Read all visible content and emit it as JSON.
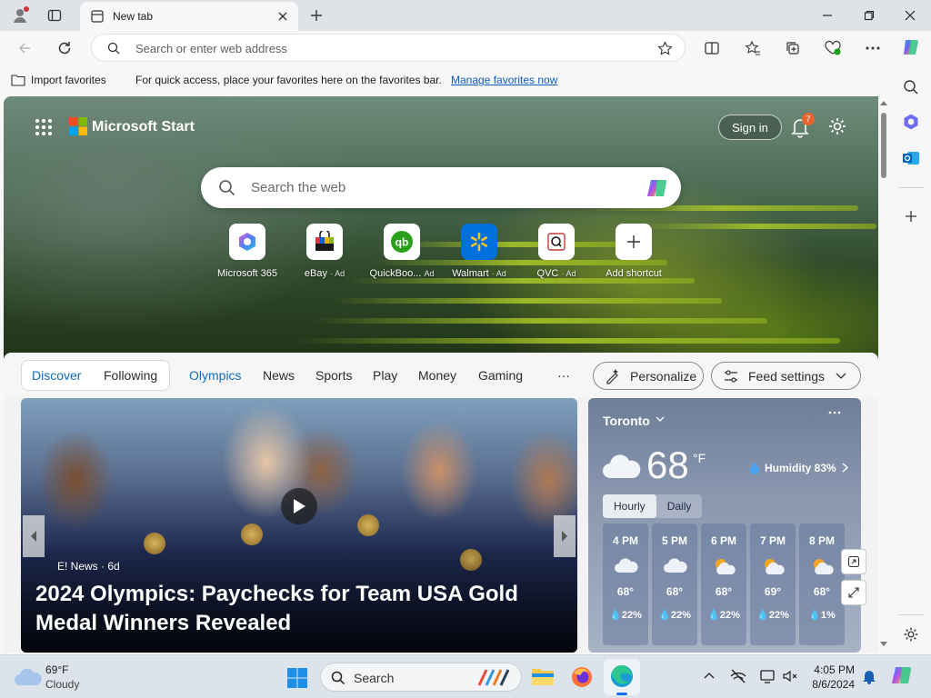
{
  "browser": {
    "tab_title": "New tab",
    "address_placeholder": "Search or enter web address",
    "favorites": {
      "import_label": "Import favorites",
      "hint_text": "For quick access, place your favorites here on the favorites bar.",
      "manage_link": "Manage favorites now"
    }
  },
  "start": {
    "brand": "Microsoft Start",
    "sign_in": "Sign in",
    "notification_count": "7",
    "search_placeholder": "Search the web",
    "shortcuts": [
      {
        "label": "Microsoft 365",
        "ad": ""
      },
      {
        "label": "eBay",
        "ad": "· Ad"
      },
      {
        "label": "QuickBoo...",
        "ad": "Ad"
      },
      {
        "label": "Walmart",
        "ad": "· Ad"
      },
      {
        "label": "QVC",
        "ad": "· Ad"
      },
      {
        "label": "Add shortcut",
        "ad": ""
      }
    ]
  },
  "feed_nav": {
    "discover": "Discover",
    "following": "Following",
    "tabs": [
      "Olympics",
      "News",
      "Sports",
      "Play",
      "Money",
      "Gaming"
    ],
    "more": "···",
    "personalize": "Personalize",
    "feed_settings": "Feed settings"
  },
  "news": {
    "source": "E! News · 6d",
    "headline": "2024 Olympics: Paychecks for Team USA Gold Medal Winners Revealed"
  },
  "weather": {
    "city": "Toronto",
    "temp": "68",
    "unit": "°F",
    "humidity": "Humidity 83%",
    "tab_hourly": "Hourly",
    "tab_daily": "Daily",
    "hours": [
      {
        "time": "4 PM",
        "temp": "68°",
        "precip": "22%",
        "icon": "cloudy-icon"
      },
      {
        "time": "5 PM",
        "temp": "68°",
        "precip": "22%",
        "icon": "cloudy-icon"
      },
      {
        "time": "6 PM",
        "temp": "68°",
        "precip": "22%",
        "icon": "partly-sunny-icon"
      },
      {
        "time": "7 PM",
        "temp": "69°",
        "precip": "22%",
        "icon": "partly-sunny-icon"
      },
      {
        "time": "8 PM",
        "temp": "68°",
        "precip": "1%",
        "icon": "partly-sunny-icon"
      }
    ]
  },
  "taskbar": {
    "weather_temp": "69°F",
    "weather_cond": "Cloudy",
    "search_label": "Search",
    "time": "4:05 PM",
    "date": "8/6/2024"
  },
  "colors": {
    "accent": "#0f6cbd",
    "edge_blue": "#1a73e8"
  }
}
